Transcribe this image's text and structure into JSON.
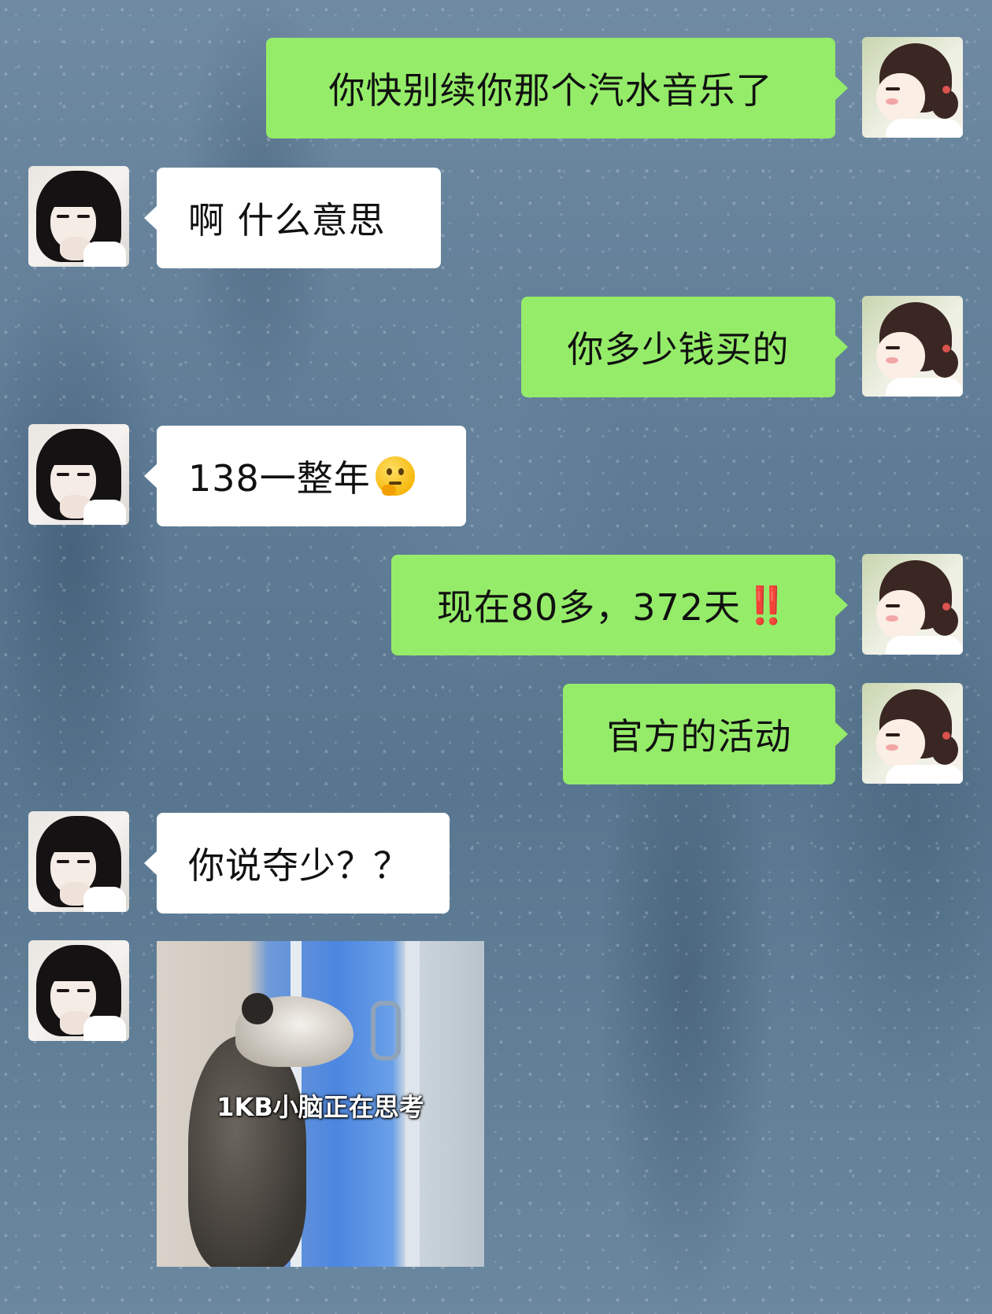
{
  "conversation": {
    "messages": [
      {
        "sender": "me",
        "type": "text",
        "text": "你快别续你那个汽水音乐了"
      },
      {
        "sender": "them",
        "type": "text",
        "text": "啊 什么意思"
      },
      {
        "sender": "me",
        "type": "text",
        "text": "你多少钱买的"
      },
      {
        "sender": "them",
        "type": "text",
        "text": "138一整年",
        "emoji": "thinking-face-emoji"
      },
      {
        "sender": "me",
        "type": "text",
        "text": "现在80多，372天",
        "emoji": "‼️"
      },
      {
        "sender": "me",
        "type": "text",
        "text": "官方的活动"
      },
      {
        "sender": "them",
        "type": "text",
        "text": "你说夺少？？"
      },
      {
        "sender": "them",
        "type": "image",
        "caption": "1KB小脑正在思考",
        "image_subject": "opossum-at-window"
      }
    ]
  },
  "colors": {
    "outgoing_bubble": "#95ec69",
    "incoming_bubble": "#ffffff",
    "exclamation": "#e3242b"
  }
}
